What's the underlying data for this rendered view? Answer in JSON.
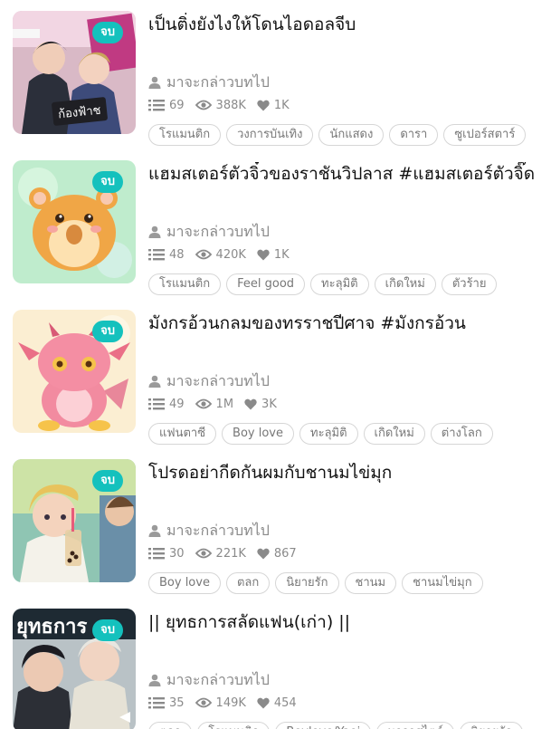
{
  "status_badge": "จบ",
  "novels": [
    {
      "title": "เป็นติ่งยังไงให้โดนไอดอลจีบ",
      "author": "มาจะกล่าวบทไป",
      "chapters": "69",
      "views": "388K",
      "likes": "1K",
      "tags": [
        "โรแมนติก",
        "วงการบันเทิง",
        "นักแสดง",
        "ดารา",
        "ซูเปอร์สตาร์"
      ]
    },
    {
      "title": "แฮมสเตอร์ตัวจิ๋วของราชันวิปลาส #แฮมสเตอร์ตัวจิ๊ด",
      "author": "มาจะกล่าวบทไป",
      "chapters": "48",
      "views": "420K",
      "likes": "1K",
      "tags": [
        "โรแมนติก",
        "Feel good",
        "ทะลุมิติ",
        "เกิดใหม่",
        "ตัวร้าย"
      ]
    },
    {
      "title": "มังกรอ้วนกลมของทรราชปีศาจ #มังกรอ้วน",
      "author": "มาจะกล่าวบทไป",
      "chapters": "49",
      "views": "1M",
      "likes": "3K",
      "tags": [
        "แฟนตาซี",
        "Boy love",
        "ทะลุมิติ",
        "เกิดใหม่",
        "ต่างโลก"
      ]
    },
    {
      "title": "โปรดอย่ากีดกันผมกับชานมไข่มุก",
      "author": "มาจะกล่าวบทไป",
      "chapters": "30",
      "views": "221K",
      "likes": "867",
      "tags": [
        "Boy love",
        "ตลก",
        "นิยายรัก",
        "ชานม",
        "ชานมไข่มุก"
      ]
    },
    {
      "title": "|| ยุทธการสลัดแฟน(เก่า) ||",
      "author": "มาจะกล่าวบทไป",
      "chapters": "35",
      "views": "149K",
      "likes": "454",
      "tags": [
        "ตลก",
        "โรแมนติก",
        "Boylove/Yaoi",
        "นาวาสไตล์",
        "นิยายรัก"
      ]
    }
  ],
  "covers": [
    {
      "art": "two men with sign",
      "lettering": "ก้องฟ้าช"
    },
    {
      "art": "orange hamster"
    },
    {
      "art": "pink baby dragon"
    },
    {
      "art": "boy drinking bubble tea"
    },
    {
      "art": "two men portrait",
      "lettering": "ยุทธการ"
    }
  ]
}
